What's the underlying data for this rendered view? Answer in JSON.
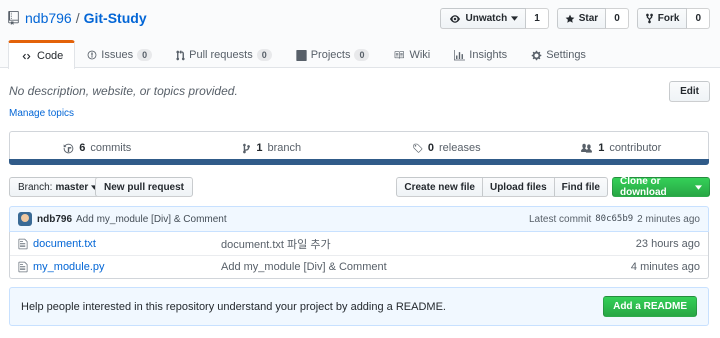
{
  "repo": {
    "owner": "ndb796",
    "separator": "/",
    "name": "Git-Study"
  },
  "actions": {
    "watch_label": "Unwatch",
    "watch_count": "1",
    "star_label": "Star",
    "star_count": "0",
    "fork_label": "Fork",
    "fork_count": "0"
  },
  "tabs": [
    {
      "label": "Code",
      "counter": "",
      "icon": "code-icon"
    },
    {
      "label": "Issues",
      "counter": "0",
      "icon": "issue-icon"
    },
    {
      "label": "Pull requests",
      "counter": "0",
      "icon": "pull-request-icon"
    },
    {
      "label": "Projects",
      "counter": "0",
      "icon": "project-icon"
    },
    {
      "label": "Wiki",
      "counter": "",
      "icon": "book-icon"
    },
    {
      "label": "Insights",
      "counter": "",
      "icon": "graph-icon"
    },
    {
      "label": "Settings",
      "counter": "",
      "icon": "gear-icon"
    }
  ],
  "description": "No description, website, or topics provided.",
  "manage_topics": "Manage topics",
  "edit_label": "Edit",
  "summary": {
    "commits_count": "6",
    "commits_label": "commits",
    "branch_count": "1",
    "branch_label": "branch",
    "releases_count": "0",
    "releases_label": "releases",
    "contributors_count": "1",
    "contributors_label": "contributor"
  },
  "branch": {
    "prefix": "Branch:",
    "name": "master"
  },
  "new_pull_request": "New pull request",
  "file_nav": {
    "create": "Create new file",
    "upload": "Upload files",
    "find": "Find file"
  },
  "clone_label": "Clone or download",
  "latest_commit": {
    "author": "ndb796",
    "message": "Add my_module [Div] & Comment",
    "prefix": "Latest commit",
    "sha": "80c65b9",
    "age": "2 minutes ago"
  },
  "files": [
    {
      "name": "document.txt",
      "message": "document.txt 파일 추가",
      "age": "23 hours ago",
      "icon": "file-icon"
    },
    {
      "name": "my_module.py",
      "message": "Add my_module [Div] & Comment",
      "age": "4 minutes ago",
      "icon": "file-icon"
    }
  ],
  "readme": {
    "text": "Help people interested in this repository understand your project by adding a README.",
    "button": "Add a README"
  },
  "colors": {
    "link": "#0366d6",
    "accent_tab": "#e36209",
    "language_bar": "#305b89",
    "green": "#28a745"
  }
}
